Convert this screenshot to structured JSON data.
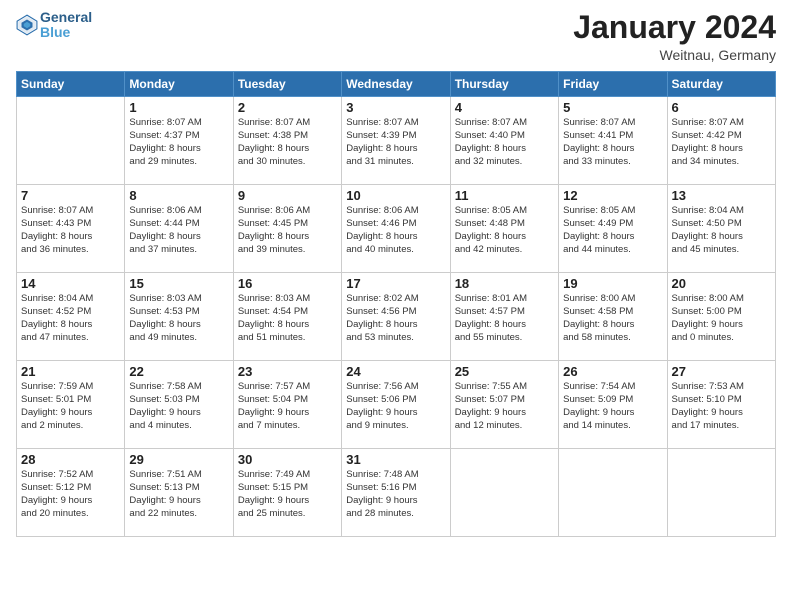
{
  "header": {
    "logo_line1": "General",
    "logo_line2": "Blue",
    "month_year": "January 2024",
    "location": "Weitnau, Germany"
  },
  "weekdays": [
    "Sunday",
    "Monday",
    "Tuesday",
    "Wednesday",
    "Thursday",
    "Friday",
    "Saturday"
  ],
  "weeks": [
    [
      {
        "day": "",
        "sunrise": "",
        "sunset": "",
        "daylight": ""
      },
      {
        "day": "1",
        "sunrise": "Sunrise: 8:07 AM",
        "sunset": "Sunset: 4:37 PM",
        "daylight": "Daylight: 8 hours and 29 minutes."
      },
      {
        "day": "2",
        "sunrise": "Sunrise: 8:07 AM",
        "sunset": "Sunset: 4:38 PM",
        "daylight": "Daylight: 8 hours and 30 minutes."
      },
      {
        "day": "3",
        "sunrise": "Sunrise: 8:07 AM",
        "sunset": "Sunset: 4:39 PM",
        "daylight": "Daylight: 8 hours and 31 minutes."
      },
      {
        "day": "4",
        "sunrise": "Sunrise: 8:07 AM",
        "sunset": "Sunset: 4:40 PM",
        "daylight": "Daylight: 8 hours and 32 minutes."
      },
      {
        "day": "5",
        "sunrise": "Sunrise: 8:07 AM",
        "sunset": "Sunset: 4:41 PM",
        "daylight": "Daylight: 8 hours and 33 minutes."
      },
      {
        "day": "6",
        "sunrise": "Sunrise: 8:07 AM",
        "sunset": "Sunset: 4:42 PM",
        "daylight": "Daylight: 8 hours and 34 minutes."
      }
    ],
    [
      {
        "day": "7",
        "sunrise": "Sunrise: 8:07 AM",
        "sunset": "Sunset: 4:43 PM",
        "daylight": "Daylight: 8 hours and 36 minutes."
      },
      {
        "day": "8",
        "sunrise": "Sunrise: 8:06 AM",
        "sunset": "Sunset: 4:44 PM",
        "daylight": "Daylight: 8 hours and 37 minutes."
      },
      {
        "day": "9",
        "sunrise": "Sunrise: 8:06 AM",
        "sunset": "Sunset: 4:45 PM",
        "daylight": "Daylight: 8 hours and 39 minutes."
      },
      {
        "day": "10",
        "sunrise": "Sunrise: 8:06 AM",
        "sunset": "Sunset: 4:46 PM",
        "daylight": "Daylight: 8 hours and 40 minutes."
      },
      {
        "day": "11",
        "sunrise": "Sunrise: 8:05 AM",
        "sunset": "Sunset: 4:48 PM",
        "daylight": "Daylight: 8 hours and 42 minutes."
      },
      {
        "day": "12",
        "sunrise": "Sunrise: 8:05 AM",
        "sunset": "Sunset: 4:49 PM",
        "daylight": "Daylight: 8 hours and 44 minutes."
      },
      {
        "day": "13",
        "sunrise": "Sunrise: 8:04 AM",
        "sunset": "Sunset: 4:50 PM",
        "daylight": "Daylight: 8 hours and 45 minutes."
      }
    ],
    [
      {
        "day": "14",
        "sunrise": "Sunrise: 8:04 AM",
        "sunset": "Sunset: 4:52 PM",
        "daylight": "Daylight: 8 hours and 47 minutes."
      },
      {
        "day": "15",
        "sunrise": "Sunrise: 8:03 AM",
        "sunset": "Sunset: 4:53 PM",
        "daylight": "Daylight: 8 hours and 49 minutes."
      },
      {
        "day": "16",
        "sunrise": "Sunrise: 8:03 AM",
        "sunset": "Sunset: 4:54 PM",
        "daylight": "Daylight: 8 hours and 51 minutes."
      },
      {
        "day": "17",
        "sunrise": "Sunrise: 8:02 AM",
        "sunset": "Sunset: 4:56 PM",
        "daylight": "Daylight: 8 hours and 53 minutes."
      },
      {
        "day": "18",
        "sunrise": "Sunrise: 8:01 AM",
        "sunset": "Sunset: 4:57 PM",
        "daylight": "Daylight: 8 hours and 55 minutes."
      },
      {
        "day": "19",
        "sunrise": "Sunrise: 8:00 AM",
        "sunset": "Sunset: 4:58 PM",
        "daylight": "Daylight: 8 hours and 58 minutes."
      },
      {
        "day": "20",
        "sunrise": "Sunrise: 8:00 AM",
        "sunset": "Sunset: 5:00 PM",
        "daylight": "Daylight: 9 hours and 0 minutes."
      }
    ],
    [
      {
        "day": "21",
        "sunrise": "Sunrise: 7:59 AM",
        "sunset": "Sunset: 5:01 PM",
        "daylight": "Daylight: 9 hours and 2 minutes."
      },
      {
        "day": "22",
        "sunrise": "Sunrise: 7:58 AM",
        "sunset": "Sunset: 5:03 PM",
        "daylight": "Daylight: 9 hours and 4 minutes."
      },
      {
        "day": "23",
        "sunrise": "Sunrise: 7:57 AM",
        "sunset": "Sunset: 5:04 PM",
        "daylight": "Daylight: 9 hours and 7 minutes."
      },
      {
        "day": "24",
        "sunrise": "Sunrise: 7:56 AM",
        "sunset": "Sunset: 5:06 PM",
        "daylight": "Daylight: 9 hours and 9 minutes."
      },
      {
        "day": "25",
        "sunrise": "Sunrise: 7:55 AM",
        "sunset": "Sunset: 5:07 PM",
        "daylight": "Daylight: 9 hours and 12 minutes."
      },
      {
        "day": "26",
        "sunrise": "Sunrise: 7:54 AM",
        "sunset": "Sunset: 5:09 PM",
        "daylight": "Daylight: 9 hours and 14 minutes."
      },
      {
        "day": "27",
        "sunrise": "Sunrise: 7:53 AM",
        "sunset": "Sunset: 5:10 PM",
        "daylight": "Daylight: 9 hours and 17 minutes."
      }
    ],
    [
      {
        "day": "28",
        "sunrise": "Sunrise: 7:52 AM",
        "sunset": "Sunset: 5:12 PM",
        "daylight": "Daylight: 9 hours and 20 minutes."
      },
      {
        "day": "29",
        "sunrise": "Sunrise: 7:51 AM",
        "sunset": "Sunset: 5:13 PM",
        "daylight": "Daylight: 9 hours and 22 minutes."
      },
      {
        "day": "30",
        "sunrise": "Sunrise: 7:49 AM",
        "sunset": "Sunset: 5:15 PM",
        "daylight": "Daylight: 9 hours and 25 minutes."
      },
      {
        "day": "31",
        "sunrise": "Sunrise: 7:48 AM",
        "sunset": "Sunset: 5:16 PM",
        "daylight": "Daylight: 9 hours and 28 minutes."
      },
      {
        "day": "",
        "sunrise": "",
        "sunset": "",
        "daylight": ""
      },
      {
        "day": "",
        "sunrise": "",
        "sunset": "",
        "daylight": ""
      },
      {
        "day": "",
        "sunrise": "",
        "sunset": "",
        "daylight": ""
      }
    ]
  ]
}
